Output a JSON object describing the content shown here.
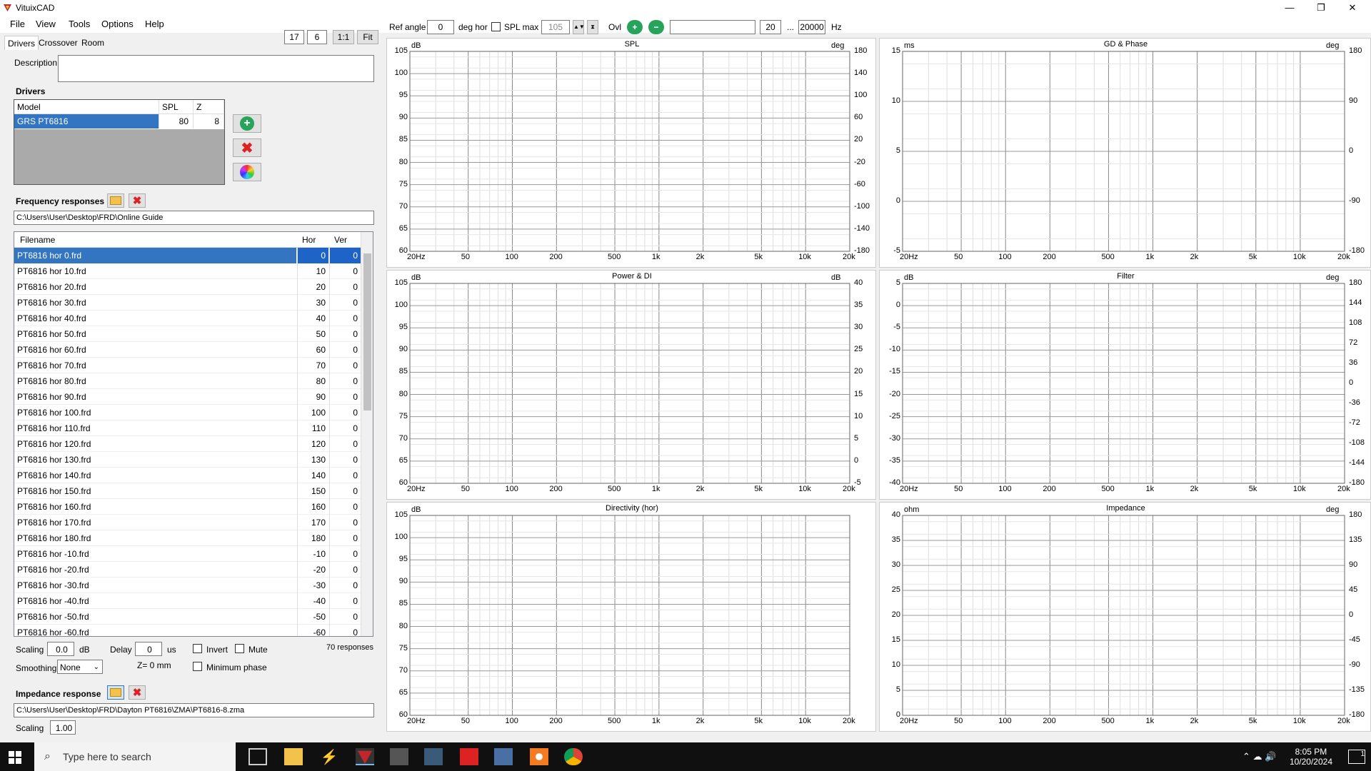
{
  "window": {
    "title": "VituixCAD",
    "minimize": "—",
    "restore": "❐",
    "close": "✕"
  },
  "menu": [
    "File",
    "View",
    "Tools",
    "Options",
    "Help"
  ],
  "tabs": [
    "Drivers",
    "Crossover",
    "Room"
  ],
  "toolbar": {
    "val1": "17",
    "val2": "6",
    "btn_11": "1:1",
    "btn_fit": "Fit",
    "ref_angle_label": "Ref angle",
    "ref_angle": "0",
    "deg_hor": "deg hor",
    "spl_max_label": "SPL max",
    "spl_max": "105",
    "ovl": "Ovl",
    "freq_lo": "20",
    "ellipsis": "...",
    "freq_hi": "20000",
    "hz": "Hz"
  },
  "description_label": "Description",
  "drivers": {
    "title": "Drivers",
    "headers": [
      "Model",
      "SPL",
      "Z"
    ],
    "rows": [
      {
        "model": "GRS PT6816",
        "spl": "80",
        "z": "8"
      }
    ]
  },
  "freq_responses": {
    "title": "Frequency responses",
    "path": "C:\\Users\\User\\Desktop\\FRD\\Online Guide",
    "headers": [
      "Filename",
      "Hor",
      "Ver"
    ],
    "rows": [
      [
        "PT6816 hor 0.frd",
        "0",
        "0"
      ],
      [
        "PT6816 hor 10.frd",
        "10",
        "0"
      ],
      [
        "PT6816 hor 20.frd",
        "20",
        "0"
      ],
      [
        "PT6816 hor 30.frd",
        "30",
        "0"
      ],
      [
        "PT6816 hor 40.frd",
        "40",
        "0"
      ],
      [
        "PT6816 hor 50.frd",
        "50",
        "0"
      ],
      [
        "PT6816 hor 60.frd",
        "60",
        "0"
      ],
      [
        "PT6816 hor 70.frd",
        "70",
        "0"
      ],
      [
        "PT6816 hor 80.frd",
        "80",
        "0"
      ],
      [
        "PT6816 hor 90.frd",
        "90",
        "0"
      ],
      [
        "PT6816 hor 100.frd",
        "100",
        "0"
      ],
      [
        "PT6816 hor 110.frd",
        "110",
        "0"
      ],
      [
        "PT6816 hor 120.frd",
        "120",
        "0"
      ],
      [
        "PT6816 hor 130.frd",
        "130",
        "0"
      ],
      [
        "PT6816 hor 140.frd",
        "140",
        "0"
      ],
      [
        "PT6816 hor 150.frd",
        "150",
        "0"
      ],
      [
        "PT6816 hor 160.frd",
        "160",
        "0"
      ],
      [
        "PT6816 hor 170.frd",
        "170",
        "0"
      ],
      [
        "PT6816 hor 180.frd",
        "180",
        "0"
      ],
      [
        "PT6816 hor -10.frd",
        "-10",
        "0"
      ],
      [
        "PT6816 hor -20.frd",
        "-20",
        "0"
      ],
      [
        "PT6816 hor -30.frd",
        "-30",
        "0"
      ],
      [
        "PT6816 hor -40.frd",
        "-40",
        "0"
      ],
      [
        "PT6816 hor -50.frd",
        "-50",
        "0"
      ],
      [
        "PT6816 hor -60.frd",
        "-60",
        "0"
      ]
    ]
  },
  "controls": {
    "scaling_label": "Scaling",
    "scaling": "0.0",
    "db": "dB",
    "delay_label": "Delay",
    "delay": "0",
    "us": "us",
    "invert": "Invert",
    "mute": "Mute",
    "responses": "70 responses",
    "smoothing_label": "Smoothing",
    "smoothing": "None",
    "z_label": "Z= 0 mm",
    "min_phase": "Minimum phase"
  },
  "impedance": {
    "title": "Impedance response",
    "path": "C:\\Users\\User\\Desktop\\FRD\\Dayton PT6816\\ZMA\\PT6816-8.zma",
    "scaling_label": "Scaling",
    "scaling": "1.00"
  },
  "xticks": [
    "20Hz",
    "50",
    "100",
    "200",
    "500",
    "1k",
    "2k",
    "5k",
    "10k",
    "20k"
  ],
  "graphs": [
    {
      "id": "spl",
      "title": "SPL",
      "lunit": "dB",
      "runit": "deg",
      "left": [
        "105",
        "100",
        "95",
        "90",
        "85",
        "80",
        "75",
        "70",
        "65",
        "60"
      ],
      "right": [
        "180",
        "140",
        "100",
        "60",
        "20",
        "-20",
        "-60",
        "-100",
        "-140",
        "-180"
      ]
    },
    {
      "id": "gd",
      "title": "GD & Phase",
      "lunit": "ms",
      "runit": "deg",
      "left": [
        "15",
        "10",
        "5",
        "0",
        "-5"
      ],
      "right": [
        "180",
        "90",
        "0",
        "-90",
        "-180"
      ]
    },
    {
      "id": "power",
      "title": "Power & DI",
      "lunit": "dB",
      "runit": "dB",
      "left": [
        "105",
        "100",
        "95",
        "90",
        "85",
        "80",
        "75",
        "70",
        "65",
        "60"
      ],
      "right": [
        "40",
        "35",
        "30",
        "25",
        "20",
        "15",
        "10",
        "5",
        "0",
        "-5"
      ]
    },
    {
      "id": "filter",
      "title": "Filter",
      "lunit": "dB",
      "runit": "deg",
      "left": [
        "5",
        "0",
        "-5",
        "-10",
        "-15",
        "-20",
        "-25",
        "-30",
        "-35",
        "-40"
      ],
      "right": [
        "180",
        "144",
        "108",
        "72",
        "36",
        "0",
        "-36",
        "-72",
        "-108",
        "-144",
        "-180"
      ]
    },
    {
      "id": "dir",
      "title": "Directivity (hor)",
      "lunit": "dB",
      "runit": "",
      "left": [
        "105",
        "100",
        "95",
        "90",
        "85",
        "80",
        "75",
        "70",
        "65",
        "60"
      ],
      "right": []
    },
    {
      "id": "imp",
      "title": "Impedance",
      "lunit": "ohm",
      "runit": "deg",
      "left": [
        "40",
        "35",
        "30",
        "25",
        "20",
        "15",
        "10",
        "5",
        "0"
      ],
      "right": [
        "180",
        "135",
        "90",
        "45",
        "0",
        "-45",
        "-90",
        "-135",
        "-180"
      ]
    }
  ],
  "taskbar": {
    "search": "Type here to search",
    "time": "8:05 PM",
    "date": "10/20/2024",
    "notif": "1"
  }
}
